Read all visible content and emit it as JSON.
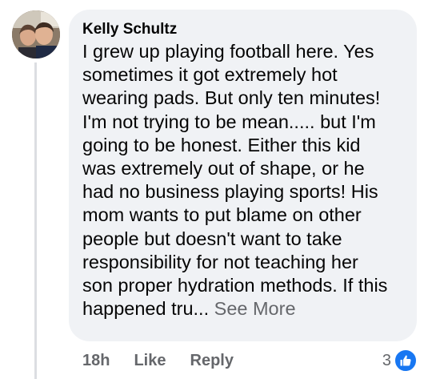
{
  "comment": {
    "author": "Kelly Schultz",
    "text_lines": [
      "I grew up playing football here.  Yes",
      "sometimes it got extremely hot",
      "wearing pads. But only ten minutes!",
      "I'm not trying to be mean..... but I'm",
      "going to be honest. Either this kid",
      "was extremely out of shape, or he",
      "had no business playing sports! His",
      "mom wants to put blame on other",
      "people but doesn't want to take",
      "responsibility for not teaching her",
      "son proper hydration methods. If this",
      "happened tru..."
    ],
    "see_more_label": "See More"
  },
  "actions": {
    "timestamp": "18h",
    "like_label": "Like",
    "reply_label": "Reply"
  },
  "reactions": {
    "count": "3",
    "icon": "thumbs-up-icon",
    "badge_color": "#1877f2"
  },
  "colors": {
    "bubble": "#f0f2f5",
    "muted_text": "#65676b",
    "primary_text": "#050505"
  }
}
